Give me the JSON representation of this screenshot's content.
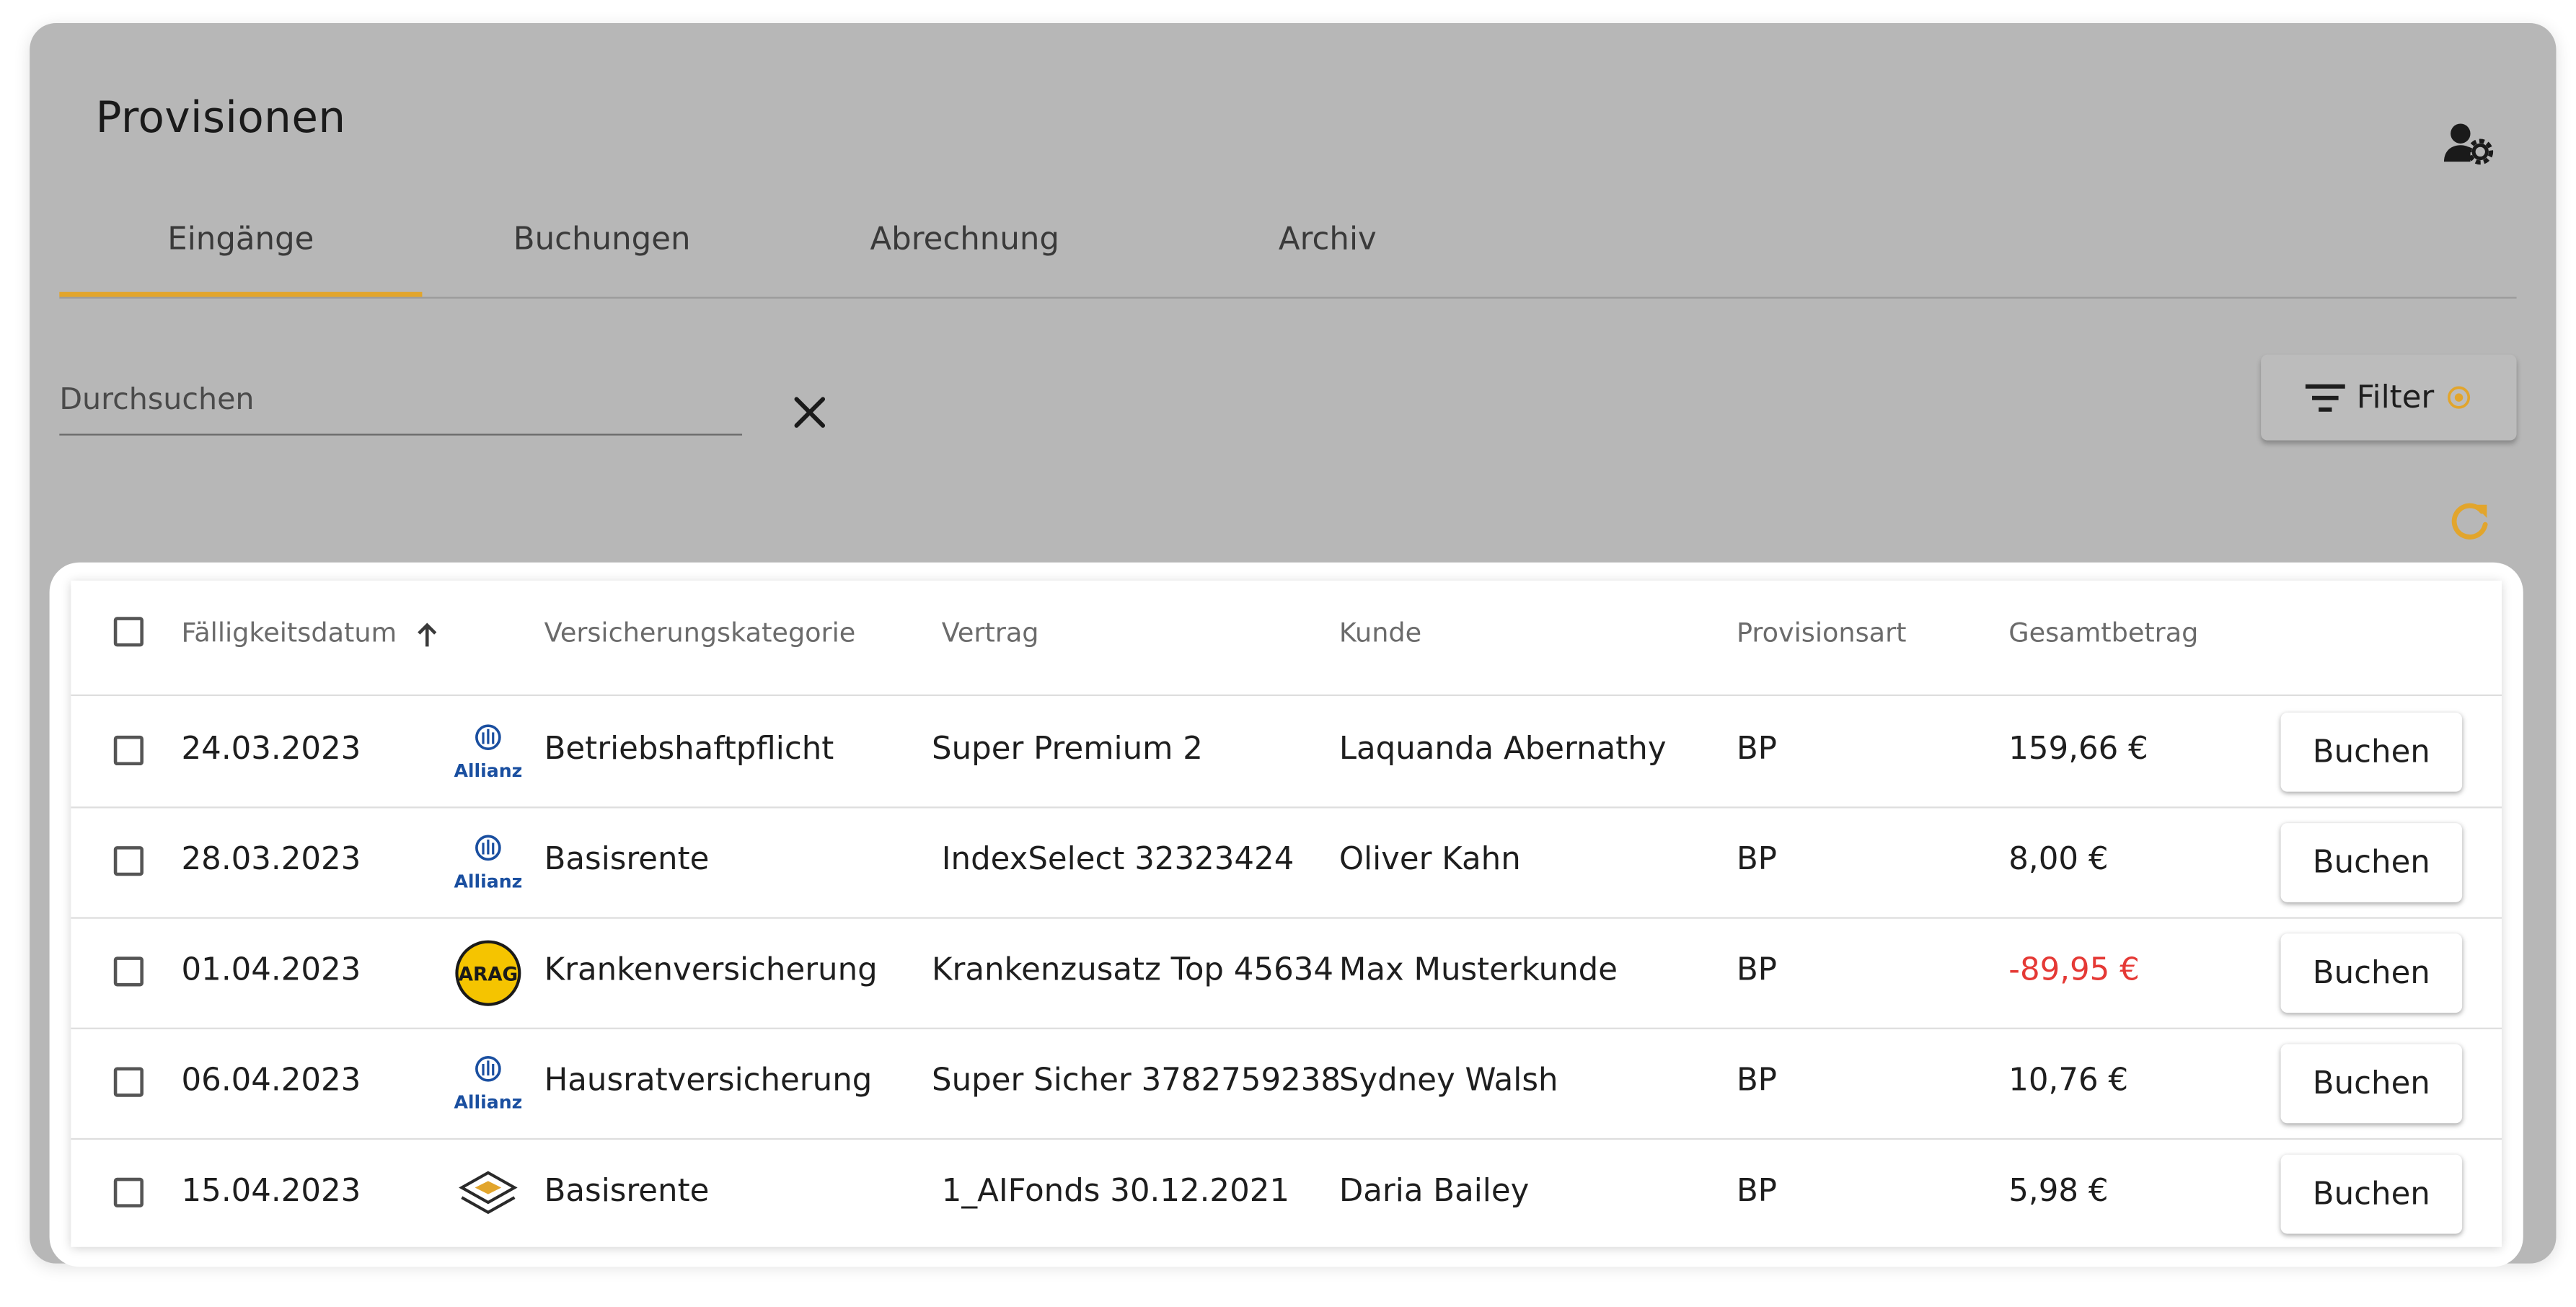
{
  "page": {
    "title": "Provisionen"
  },
  "tabs": [
    {
      "label": "Eingänge",
      "active": true
    },
    {
      "label": "Buchungen",
      "active": false
    },
    {
      "label": "Abrechnung",
      "active": false
    },
    {
      "label": "Archiv",
      "active": false
    }
  ],
  "search": {
    "placeholder": "Durchsuchen",
    "value": ""
  },
  "filter": {
    "label": "Filter"
  },
  "colors": {
    "accent": "#e2a52c",
    "negative": "#e53935",
    "panel": "#b7b7b7",
    "allianz": "#1a4fa0",
    "arrag": "#f5c400"
  },
  "icons": {
    "user_settings": "user-settings-icon",
    "clear": "close-icon",
    "filter": "filter-icon",
    "filter_indicator": "radio-dot-icon",
    "refresh": "refresh-icon",
    "sort": "arrow-up-icon"
  },
  "table": {
    "columns": {
      "date": "Fälligkeitsdatum",
      "category": "Versicherungskategorie",
      "contract": "Vertrag",
      "customer": "Kunde",
      "type": "Provisionsart",
      "amount": "Gesamtbetrag"
    },
    "rows": [
      {
        "date": "24.03.2023",
        "logo": "Allianz",
        "category": "Betriebshaftpflicht",
        "contract": "Super Premium 2",
        "customer": "Laquanda Abernathy",
        "type": "BP",
        "amount": "159,66 €",
        "negative": false,
        "action": "Buchen"
      },
      {
        "date": "28.03.2023",
        "logo": "Allianz",
        "category": "Basisrente",
        "contract": "IndexSelect 32323424",
        "customer": "Oliver Kahn",
        "type": "BP",
        "amount": "8,00 €",
        "negative": false,
        "action": "Buchen"
      },
      {
        "date": "01.04.2023",
        "logo": "ARAG",
        "category": "Krankenversicherung",
        "contract": "Krankenzusatz  Top 45634",
        "customer": "Max Musterkunde",
        "type": "BP",
        "amount": "-89,95 €",
        "negative": true,
        "action": "Buchen"
      },
      {
        "date": "06.04.2023",
        "logo": "Allianz",
        "category": "Hausratversicherung",
        "contract": "Super Sicher 3782759238",
        "customer": "Sydney Walsh",
        "type": "BP",
        "amount": "10,76 €",
        "negative": false,
        "action": "Buchen"
      },
      {
        "date": "15.04.2023",
        "logo": "layers",
        "category": "Basisrente",
        "contract": "1_AIFonds 30.12.2021",
        "customer": "Daria Bailey",
        "type": "BP",
        "amount": "5,98 €",
        "negative": false,
        "action": "Buchen"
      }
    ]
  }
}
